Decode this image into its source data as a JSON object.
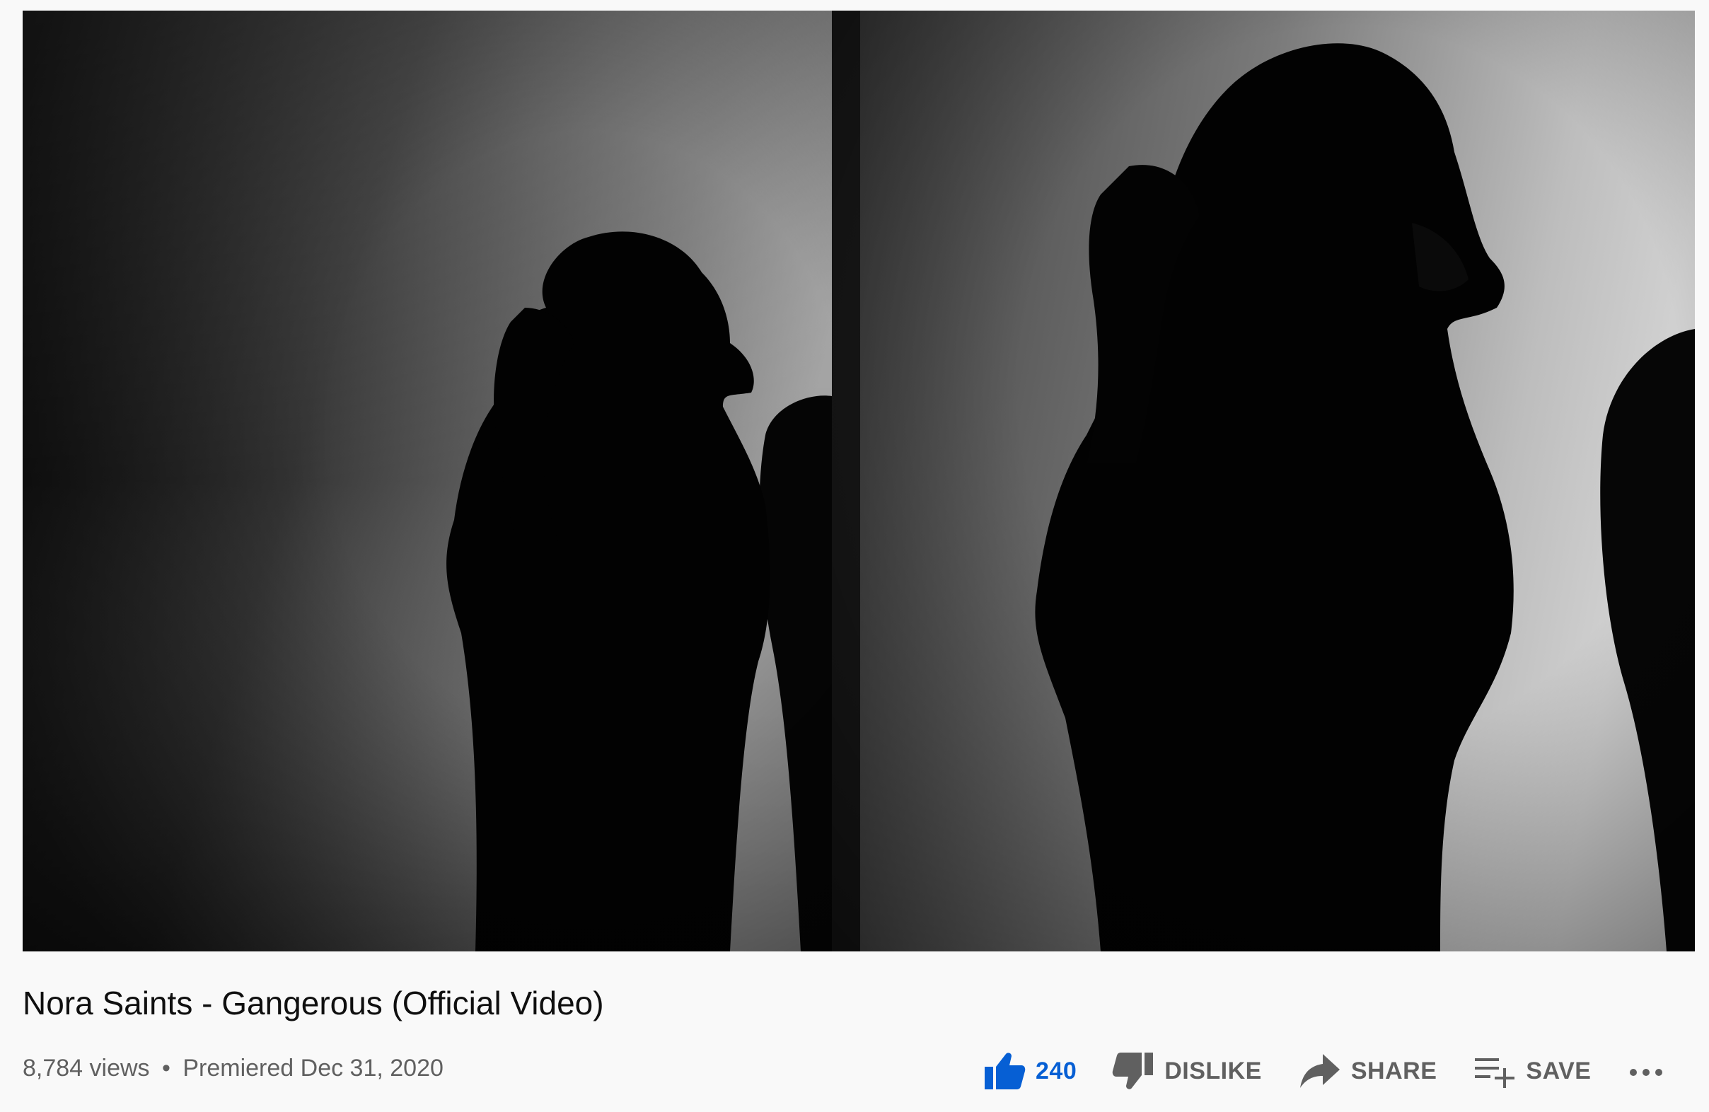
{
  "video": {
    "title": "Nora Saints - Gangerous (Official Video)",
    "views": "8,784 views",
    "separator": "•",
    "premiere": "Premiered Dec 31, 2020"
  },
  "actions": {
    "like_count": "240",
    "dislike_label": "DISLIKE",
    "share_label": "SHARE",
    "save_label": "SAVE"
  },
  "colors": {
    "like_accent": "#065fd4",
    "secondary_text": "#606060",
    "primary_text": "#0f0f0f",
    "background": "#f9f9f9"
  },
  "icons": {
    "like": "thumb-up-icon",
    "dislike": "thumb-down-icon",
    "share": "share-arrow-icon",
    "save": "playlist-add-icon",
    "more": "more-horizontal-icon"
  }
}
